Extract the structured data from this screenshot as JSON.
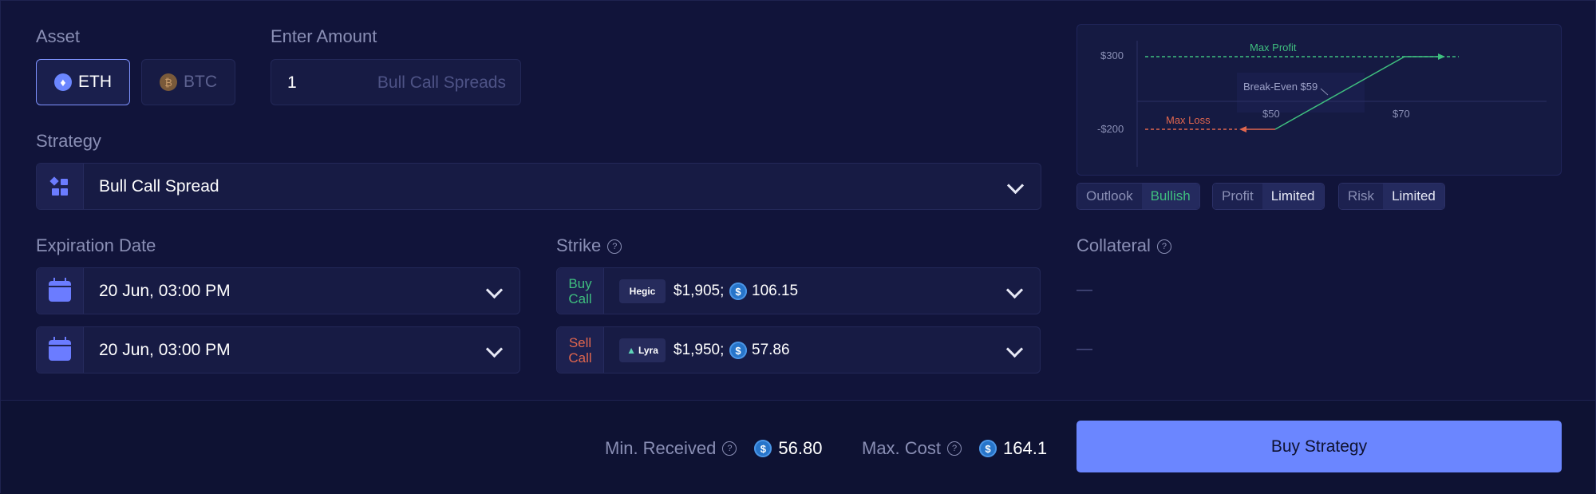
{
  "asset": {
    "label": "Asset",
    "options": [
      "ETH",
      "BTC"
    ],
    "selected": "ETH"
  },
  "amount": {
    "label": "Enter Amount",
    "value": "1",
    "suffix": "Bull Call Spreads"
  },
  "strategy": {
    "label": "Strategy",
    "value": "Bull Call Spread"
  },
  "expiration": {
    "label": "Expiration Date",
    "dates": [
      "20 Jun, 03:00 PM",
      "20 Jun, 03:00 PM"
    ]
  },
  "strike": {
    "label": "Strike",
    "legs": [
      {
        "side_line1": "Buy",
        "side_line2": "Call",
        "venue": "Hegic",
        "price": "$1,905;",
        "premium": "106.15",
        "color": "#3fbf7f"
      },
      {
        "side_line1": "Sell",
        "side_line2": "Call",
        "venue": "Lyra",
        "price": "$1,950;",
        "premium": "57.86",
        "color": "#e0664e"
      }
    ]
  },
  "collateral": {
    "label": "Collateral",
    "values": [
      "—",
      "—"
    ]
  },
  "payoff_chart": {
    "max_profit_label": "Max Profit",
    "max_loss_label": "Max Loss",
    "breakeven_label": "Break-Even $59",
    "y_ticks": [
      "$300",
      "-$200"
    ],
    "x_ticks": [
      "$50",
      "$70"
    ]
  },
  "tags": [
    {
      "key": "Outlook",
      "value": "Bullish",
      "color": "#3fbf7f"
    },
    {
      "key": "Profit",
      "value": "Limited",
      "color": "#e6e8f5"
    },
    {
      "key": "Risk",
      "value": "Limited",
      "color": "#e6e8f5"
    }
  ],
  "footer": {
    "min_received_label": "Min. Received",
    "min_received_value": "56.80",
    "max_cost_label": "Max. Cost",
    "max_cost_value": "164.1",
    "buy_button": "Buy Strategy"
  },
  "colors": {
    "accent": "#6b86ff",
    "green": "#3fbf7f",
    "red": "#e0664e",
    "bg": "#11143a"
  }
}
